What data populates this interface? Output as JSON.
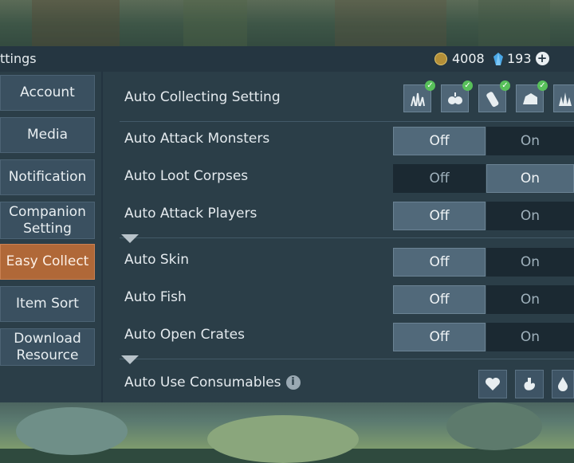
{
  "header": {
    "title": "ttings",
    "gold_amount": "4008",
    "crystal_amount": "193",
    "plus_symbol": "+"
  },
  "sidebar": {
    "items": [
      {
        "label": "Account"
      },
      {
        "label": "Media"
      },
      {
        "label": "Notification"
      },
      {
        "label_line1": "Companion",
        "label_line2": "Setting"
      },
      {
        "label": "Easy Collect"
      },
      {
        "label": "Item Sort"
      },
      {
        "label_line1": "Download",
        "label_line2": "Resource"
      }
    ],
    "active_label": "Easy Collect"
  },
  "settings": {
    "auto_collecting": {
      "label": "Auto Collecting Setting",
      "icons": [
        "grass-icon",
        "berries-icon",
        "wood-log-icon",
        "stone-icon",
        "crystal-ore-icon"
      ],
      "checked": [
        true,
        true,
        true,
        true,
        false
      ]
    },
    "rows": [
      {
        "label": "Auto Attack Monsters",
        "off": "Off",
        "on": "On",
        "selected": "Off"
      },
      {
        "label": "Auto Loot Corpses",
        "off": "Off",
        "on": "On",
        "selected": "On"
      },
      {
        "label": "Auto Attack Players",
        "off": "Off",
        "on": "On",
        "selected": "Off"
      },
      {
        "label": "Auto Skin",
        "off": "Off",
        "on": "On",
        "selected": "Off"
      },
      {
        "label": "Auto Fish",
        "off": "Off",
        "on": "On",
        "selected": "Off"
      },
      {
        "label": "Auto Open Crates",
        "off": "Off",
        "on": "On",
        "selected": "Off"
      }
    ],
    "consumables": {
      "label": "Auto Use Consumables",
      "info_symbol": "i",
      "icons": [
        "heart-icon",
        "stomach-icon",
        "water-drop-icon"
      ]
    }
  },
  "colors": {
    "active_tab": "#b06838",
    "panel": "#2b3e48",
    "check": "#58c05a"
  }
}
